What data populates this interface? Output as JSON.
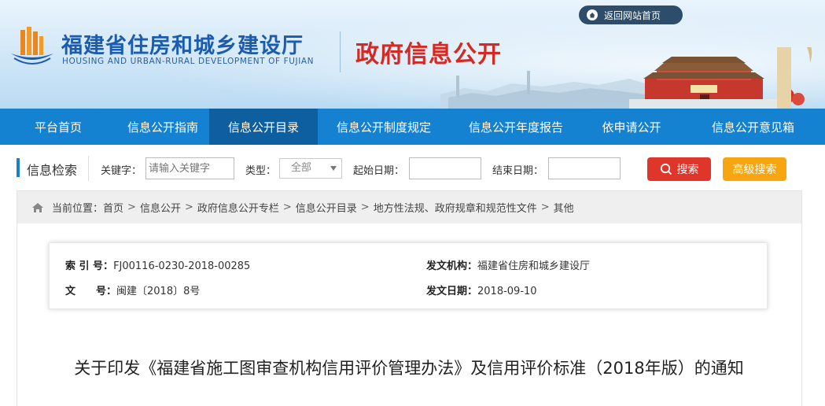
{
  "header": {
    "title_cn": "福建省住房和城乡建设厅",
    "title_en": "HOUSING AND URBAN-RURAL DEVELOPMENT OF FUJIAN",
    "section_title": "政府信息公开",
    "back_label": "返回网站首页",
    "brand_blue": "#1c5cae",
    "section_red": "#d52a23"
  },
  "nav": {
    "items": [
      {
        "label": "平台首页"
      },
      {
        "label": "信息公开指南"
      },
      {
        "label": "信息公开目录"
      },
      {
        "label": "信息公开制度规定"
      },
      {
        "label": "信息公开年度报告"
      },
      {
        "label": "依申请公开"
      },
      {
        "label": "信息公开意见箱"
      }
    ],
    "active_index": 2,
    "bg_color": "#1581d1",
    "active_color": "#0e5f9f"
  },
  "search": {
    "title": "信息检索",
    "keyword_label": "关键字：",
    "keyword_placeholder": "请输入关键字",
    "type_label": "类型：",
    "type_value": "全部",
    "start_label": "起始日期：",
    "end_label": "结束日期：",
    "search_button": "搜索",
    "advanced_button": "高级搜索"
  },
  "breadcrumb": {
    "prefix": "当前位置：",
    "items": [
      "首页",
      "信息公开",
      "政府信息公开专栏",
      "信息公开目录",
      "地方性法规、政府规章和规范性文件",
      "其他"
    ],
    "separator": ">"
  },
  "meta": {
    "index_label": "索 引 号：",
    "index_value": "FJ00116-0230-2018-00285",
    "issuer_label": "发文机构：",
    "issuer_value": "福建省住房和城乡建设厅",
    "docno_label": "文　　号：",
    "docno_value": "闽建〔2018〕8号",
    "date_label": "发文日期：",
    "date_value": "2018-09-10"
  },
  "document": {
    "title": "关于印发《福建省施工图审查机构信用评价管理办法》及信用评价标准（2018年版）的通知"
  },
  "icons": {
    "logo": "building-logo-icon",
    "home": "home-icon",
    "search": "search-icon",
    "caret": "chevron-down-icon"
  }
}
